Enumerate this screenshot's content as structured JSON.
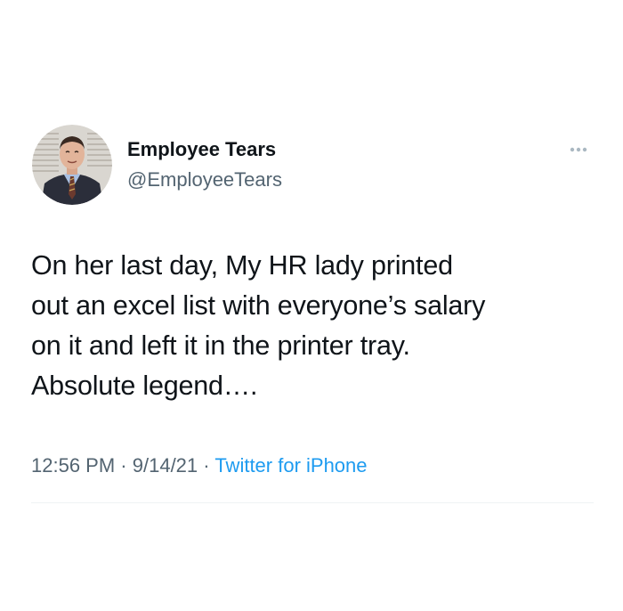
{
  "author": {
    "display_name": "Employee Tears",
    "handle": "@EmployeeTears",
    "avatar_icon": "avatar-photo"
  },
  "more_icon": "more-options-icon",
  "tweet": {
    "text": "On her last day, My HR lady printed\nout an excel list with everyone’s salary\non it and left it in the printer tray.\nAbsolute legend…."
  },
  "meta": {
    "time": "12:56 PM",
    "separator": "·",
    "date": "9/14/21",
    "source": "Twitter for iPhone"
  },
  "colors": {
    "text": "#0f1419",
    "secondary": "#536471",
    "link": "#1d9bf0",
    "divider": "#eff3f4"
  }
}
